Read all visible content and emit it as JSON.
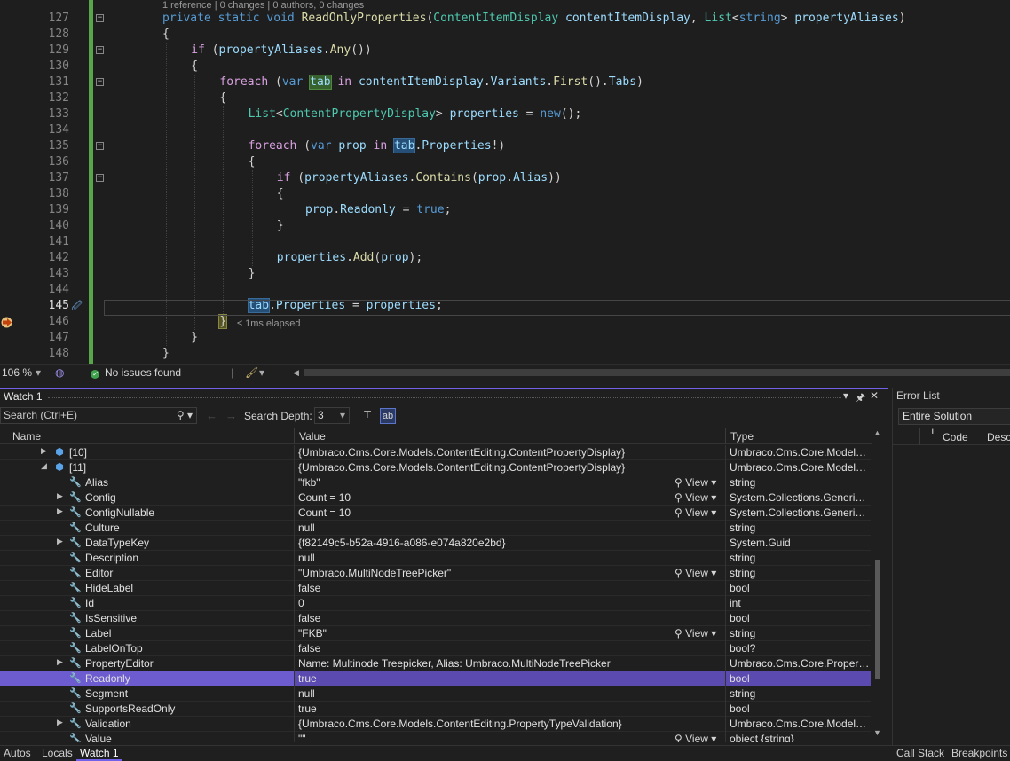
{
  "editor": {
    "codelens": "1 reference | 0 changes | 0 authors, 0 changes",
    "elapsed": "≤ 1ms elapsed",
    "lines": [
      {
        "n": "127",
        "indent": 0,
        "tokens": [
          [
            "kw",
            "private "
          ],
          [
            "kw",
            "static "
          ],
          [
            "kw",
            "void "
          ],
          [
            "mt",
            "ReadOnlyProperties"
          ],
          [
            "pl",
            "("
          ],
          [
            "ty",
            "ContentItemDisplay"
          ],
          [
            "pl",
            " "
          ],
          [
            "pa",
            "contentItemDisplay"
          ],
          [
            "pl",
            ", "
          ],
          [
            "ty",
            "List"
          ],
          [
            "pl",
            "<"
          ],
          [
            "kw",
            "string"
          ],
          [
            "pl",
            "> "
          ],
          [
            "pa",
            "propertyAliases"
          ],
          [
            "pl",
            ")"
          ]
        ],
        "fold": true
      },
      {
        "n": "128",
        "indent": 0,
        "tokens": [
          [
            "pl",
            "{"
          ]
        ]
      },
      {
        "n": "129",
        "indent": 1,
        "tokens": [
          [
            "ctl",
            "if "
          ],
          [
            "pl",
            "("
          ],
          [
            "pa",
            "propertyAliases"
          ],
          [
            "pl",
            "."
          ],
          [
            "mt",
            "Any"
          ],
          [
            "pl",
            "())"
          ]
        ],
        "fold": true
      },
      {
        "n": "130",
        "indent": 1,
        "tokens": [
          [
            "pl",
            "{"
          ]
        ]
      },
      {
        "n": "131",
        "indent": 2,
        "tokens": [
          [
            "ctl",
            "foreach "
          ],
          [
            "pl",
            "("
          ],
          [
            "kw",
            "var "
          ],
          [
            "pa",
            "tab",
            "g"
          ],
          [
            "pl",
            " "
          ],
          [
            "ctl",
            "in "
          ],
          [
            "pa",
            "contentItemDisplay"
          ],
          [
            "pl",
            "."
          ],
          [
            "pa",
            "Variants"
          ],
          [
            "pl",
            "."
          ],
          [
            "mt",
            "First"
          ],
          [
            "pl",
            "()."
          ],
          [
            "pa",
            "Tabs"
          ],
          [
            "pl",
            ")"
          ]
        ],
        "fold": true
      },
      {
        "n": "132",
        "indent": 2,
        "tokens": [
          [
            "pl",
            "{"
          ]
        ]
      },
      {
        "n": "133",
        "indent": 3,
        "tokens": [
          [
            "ty",
            "List"
          ],
          [
            "pl",
            "<"
          ],
          [
            "ty",
            "ContentPropertyDisplay"
          ],
          [
            "pl",
            "> "
          ],
          [
            "pa",
            "properties"
          ],
          [
            "pl",
            " = "
          ],
          [
            "kw",
            "new"
          ],
          [
            "pl",
            "();"
          ]
        ]
      },
      {
        "n": "134",
        "indent": 3,
        "tokens": []
      },
      {
        "n": "135",
        "indent": 3,
        "tokens": [
          [
            "ctl",
            "foreach "
          ],
          [
            "pl",
            "("
          ],
          [
            "kw",
            "var "
          ],
          [
            "pa",
            "prop"
          ],
          [
            "pl",
            " "
          ],
          [
            "ctl",
            "in "
          ],
          [
            "pa",
            "tab",
            "b"
          ],
          [
            "pl",
            "."
          ],
          [
            "pa",
            "Properties"
          ],
          [
            "pl",
            "!)"
          ]
        ],
        "fold": true
      },
      {
        "n": "136",
        "indent": 3,
        "tokens": [
          [
            "pl",
            "{"
          ]
        ]
      },
      {
        "n": "137",
        "indent": 4,
        "tokens": [
          [
            "ctl",
            "if "
          ],
          [
            "pl",
            "("
          ],
          [
            "pa",
            "propertyAliases"
          ],
          [
            "pl",
            "."
          ],
          [
            "mt",
            "Contains"
          ],
          [
            "pl",
            "("
          ],
          [
            "pa",
            "prop"
          ],
          [
            "pl",
            "."
          ],
          [
            "pa",
            "Alias"
          ],
          [
            "pl",
            "))"
          ]
        ],
        "fold": true
      },
      {
        "n": "138",
        "indent": 4,
        "tokens": [
          [
            "pl",
            "{"
          ]
        ]
      },
      {
        "n": "139",
        "indent": 5,
        "tokens": [
          [
            "pa",
            "prop"
          ],
          [
            "pl",
            "."
          ],
          [
            "pa",
            "Readonly"
          ],
          [
            "pl",
            " = "
          ],
          [
            "kw",
            "true"
          ],
          [
            "pl",
            ";"
          ]
        ]
      },
      {
        "n": "140",
        "indent": 4,
        "tokens": [
          [
            "pl",
            "}"
          ]
        ]
      },
      {
        "n": "141",
        "indent": 4,
        "tokens": []
      },
      {
        "n": "142",
        "indent": 4,
        "tokens": [
          [
            "pa",
            "properties"
          ],
          [
            "pl",
            "."
          ],
          [
            "mt",
            "Add"
          ],
          [
            "pl",
            "("
          ],
          [
            "pa",
            "prop"
          ],
          [
            "pl",
            ");"
          ]
        ]
      },
      {
        "n": "143",
        "indent": 3,
        "tokens": [
          [
            "pl",
            "}"
          ]
        ]
      },
      {
        "n": "144",
        "indent": 3,
        "tokens": []
      },
      {
        "n": "145",
        "indent": 3,
        "tokens": [
          [
            "pa",
            "tab",
            "b"
          ],
          [
            "pl",
            "."
          ],
          [
            "pa",
            "Properties"
          ],
          [
            "pl",
            " = "
          ],
          [
            "pa",
            "properties"
          ],
          [
            "pl",
            ";"
          ]
        ],
        "current": true
      },
      {
        "n": "146",
        "indent": 2,
        "tokens": [
          [
            "pl",
            "}",
            "y"
          ]
        ]
      },
      {
        "n": "147",
        "indent": 1,
        "tokens": [
          [
            "pl",
            "}"
          ]
        ]
      },
      {
        "n": "148",
        "indent": 0,
        "tokens": [
          [
            "pl",
            "}"
          ]
        ]
      }
    ]
  },
  "status": {
    "zoom": "106 %",
    "issues": "No issues found"
  },
  "watch": {
    "title": "Watch 1",
    "search_placeholder": "Search (Ctrl+E)",
    "search_depth_label": "Search Depth:",
    "search_depth_value": "3",
    "columns": {
      "name": "Name",
      "value": "Value",
      "type": "Type"
    },
    "rows": [
      {
        "indent": 1,
        "exp": "▶",
        "icon": "obj",
        "name": "[10]",
        "value": "{Umbraco.Cms.Core.Models.ContentEditing.ContentPropertyDisplay}",
        "view": "",
        "type": "Umbraco.Cms.Core.Models..."
      },
      {
        "indent": 1,
        "exp": "◢",
        "icon": "obj",
        "name": "[11]",
        "value": "{Umbraco.Cms.Core.Models.ContentEditing.ContentPropertyDisplay}",
        "view": "",
        "type": "Umbraco.Cms.Core.Models..."
      },
      {
        "indent": 2,
        "exp": "",
        "icon": "wr",
        "name": "Alias",
        "value": "\"fkb\"",
        "view": "View",
        "type": "string"
      },
      {
        "indent": 2,
        "exp": "▶",
        "icon": "wr",
        "name": "Config",
        "value": "Count = 10",
        "view": "View",
        "type": "System.Collections.Generic...."
      },
      {
        "indent": 2,
        "exp": "▶",
        "icon": "wr",
        "name": "ConfigNullable",
        "value": "Count = 10",
        "view": "View",
        "type": "System.Collections.Generic...."
      },
      {
        "indent": 2,
        "exp": "",
        "icon": "wr",
        "name": "Culture",
        "value": "null",
        "view": "",
        "type": "string"
      },
      {
        "indent": 2,
        "exp": "▶",
        "icon": "wr",
        "name": "DataTypeKey",
        "value": "{f82149c5-b52a-4916-a086-e074a820e2bd}",
        "view": "",
        "type": "System.Guid"
      },
      {
        "indent": 2,
        "exp": "",
        "icon": "wr",
        "name": "Description",
        "value": "null",
        "view": "",
        "type": "string"
      },
      {
        "indent": 2,
        "exp": "",
        "icon": "wr",
        "name": "Editor",
        "value": "\"Umbraco.MultiNodeTreePicker\"",
        "view": "View",
        "type": "string"
      },
      {
        "indent": 2,
        "exp": "",
        "icon": "wr",
        "name": "HideLabel",
        "value": "false",
        "view": "",
        "type": "bool"
      },
      {
        "indent": 2,
        "exp": "",
        "icon": "wr",
        "name": "Id",
        "value": "0",
        "view": "",
        "type": "int"
      },
      {
        "indent": 2,
        "exp": "",
        "icon": "wr",
        "name": "IsSensitive",
        "value": "false",
        "view": "",
        "type": "bool"
      },
      {
        "indent": 2,
        "exp": "",
        "icon": "wr",
        "name": "Label",
        "value": "\"FKB\"",
        "view": "View",
        "type": "string"
      },
      {
        "indent": 2,
        "exp": "",
        "icon": "wr",
        "name": "LabelOnTop",
        "value": "false",
        "view": "",
        "type": "bool?"
      },
      {
        "indent": 2,
        "exp": "▶",
        "icon": "wr",
        "name": "PropertyEditor",
        "value": "Name: Multinode Treepicker, Alias: Umbraco.MultiNodeTreePicker",
        "view": "",
        "type": "Umbraco.Cms.Core.Propert..."
      },
      {
        "indent": 2,
        "exp": "",
        "icon": "wr",
        "name": "Readonly",
        "value": "true",
        "view": "",
        "type": "bool",
        "selected": true
      },
      {
        "indent": 2,
        "exp": "",
        "icon": "wr",
        "name": "Segment",
        "value": "null",
        "view": "",
        "type": "string"
      },
      {
        "indent": 2,
        "exp": "",
        "icon": "wr",
        "name": "SupportsReadOnly",
        "value": "true",
        "view": "",
        "type": "bool"
      },
      {
        "indent": 2,
        "exp": "▶",
        "icon": "wr",
        "name": "Validation",
        "value": "{Umbraco.Cms.Core.Models.ContentEditing.PropertyTypeValidation}",
        "view": "",
        "type": "Umbraco.Cms.Core.Models..."
      },
      {
        "indent": 2,
        "exp": "",
        "icon": "wr",
        "name": "Value",
        "value": "\"\"",
        "view": "View",
        "type": "object {string}"
      }
    ]
  },
  "errorlist": {
    "title": "Error List",
    "scope": "Entire Solution",
    "col_code": "Code",
    "col_desc": "Desc"
  },
  "bottom_tabs": {
    "left": [
      "Autos",
      "Locals",
      "Watch 1"
    ],
    "active": "Watch 1",
    "right": [
      "Call Stack",
      "Breakpoints"
    ]
  },
  "colors": {
    "accent": "#7160e8",
    "selection": "#5b4bb0",
    "change_bar": "#57a64a"
  }
}
